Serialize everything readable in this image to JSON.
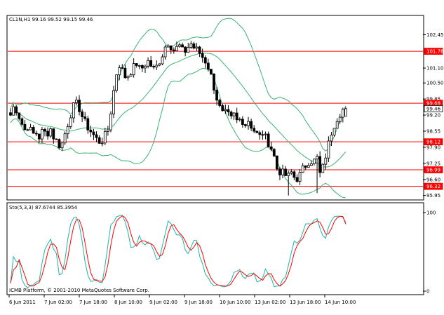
{
  "window": {
    "symbol_line": "CL1N,H1  99.16 99.52 99.15 99.46",
    "stoch_line": "Sto(5,3,3) 87.6744 85.3954",
    "copyright": "ICMB Platform, © 2001-2010 MetaQuotes Software Corp."
  },
  "colors": {
    "background": "#ffffff",
    "candle": "#000000",
    "bollinger": "#3cb371",
    "hline": "#ff0000",
    "stoch_main": "#20b2aa",
    "stoch_signal": "#ff0000",
    "price_tag_bg": "#ff0000",
    "price_tag_text": "#ffffff"
  },
  "price_axis": {
    "ticks": [
      "102.45",
      "101.10",
      "100.50",
      "99.85",
      "99.20",
      "98.55",
      "97.90",
      "97.25",
      "96.60",
      "95.95"
    ],
    "tick_values": [
      102.45,
      101.1,
      100.5,
      99.85,
      99.2,
      98.55,
      97.9,
      97.25,
      96.6,
      95.95
    ],
    "min": 95.8,
    "max": 103.2
  },
  "price_tags": [
    {
      "label": "101.78",
      "value": 101.78,
      "style": "red"
    },
    {
      "label": "99.68",
      "value": 99.68,
      "style": "red"
    },
    {
      "label": "99.46",
      "value": 99.46,
      "style": "current"
    },
    {
      "label": "98.12",
      "value": 98.12,
      "style": "red"
    },
    {
      "label": "96.99",
      "value": 96.99,
      "style": "red"
    },
    {
      "label": "96.32",
      "value": 96.32,
      "style": "red"
    }
  ],
  "stoch_axis": {
    "ticks": [
      "100",
      "0"
    ],
    "tick_values": [
      100,
      0
    ]
  },
  "time_axis": {
    "labels": [
      "6 Jun 2011",
      "7 Jun 02:00",
      "7 Jun 18:00",
      "8 Jun 10:00",
      "9 Jun 02:00",
      "9 Jun 18:00",
      "10 Jun 10:00",
      "13 Jun 02:00",
      "13 Jun 18:00",
      "14 Jun 10:00"
    ]
  },
  "chart_data": {
    "type": "candlestick",
    "symbol": "CL1N",
    "timeframe": "H1",
    "last_ohlc": {
      "open": 99.16,
      "high": 99.52,
      "low": 99.15,
      "close": 99.46
    },
    "indicators": [
      "Bollinger Bands",
      "Stochastic(5,3,3)"
    ],
    "stochastic": {
      "main": 87.6744,
      "signal": 85.3954
    },
    "hlines": [
      101.78,
      99.68,
      98.12,
      96.99,
      96.32
    ],
    "close_path": [
      99.2,
      99.6,
      99.3,
      98.9,
      98.6,
      98.8,
      98.4,
      98.5,
      98.3,
      98.6,
      98.4,
      98.7,
      98.3,
      98.1,
      97.9,
      98.4,
      98.9,
      99.4,
      99.7,
      99.5,
      99.1,
      98.8,
      98.6,
      98.4,
      98.2,
      98.1,
      98.3,
      98.6,
      99.5,
      100.6,
      101.3,
      101.0,
      100.7,
      100.9,
      101.1,
      101.3,
      101.0,
      101.2,
      101.4,
      101.2,
      101.0,
      101.3,
      101.6,
      102.0,
      102.2,
      101.8,
      101.9,
      102.0,
      101.7,
      101.9,
      102.1,
      101.9,
      101.8,
      101.6,
      101.4,
      101.1,
      100.6,
      100.0,
      99.5,
      99.2,
      99.3,
      99.0,
      99.2,
      98.9,
      99.1,
      98.8,
      99.0,
      98.7,
      98.5,
      98.3,
      98.5,
      98.2,
      98.0,
      97.6,
      97.0,
      96.9,
      96.8,
      96.7,
      96.9,
      96.6,
      96.7,
      97.0,
      97.2,
      97.4,
      97.3,
      97.5,
      96.7,
      97.3,
      97.9,
      98.5,
      98.9,
      99.2,
      99.4,
      99.5
    ]
  }
}
